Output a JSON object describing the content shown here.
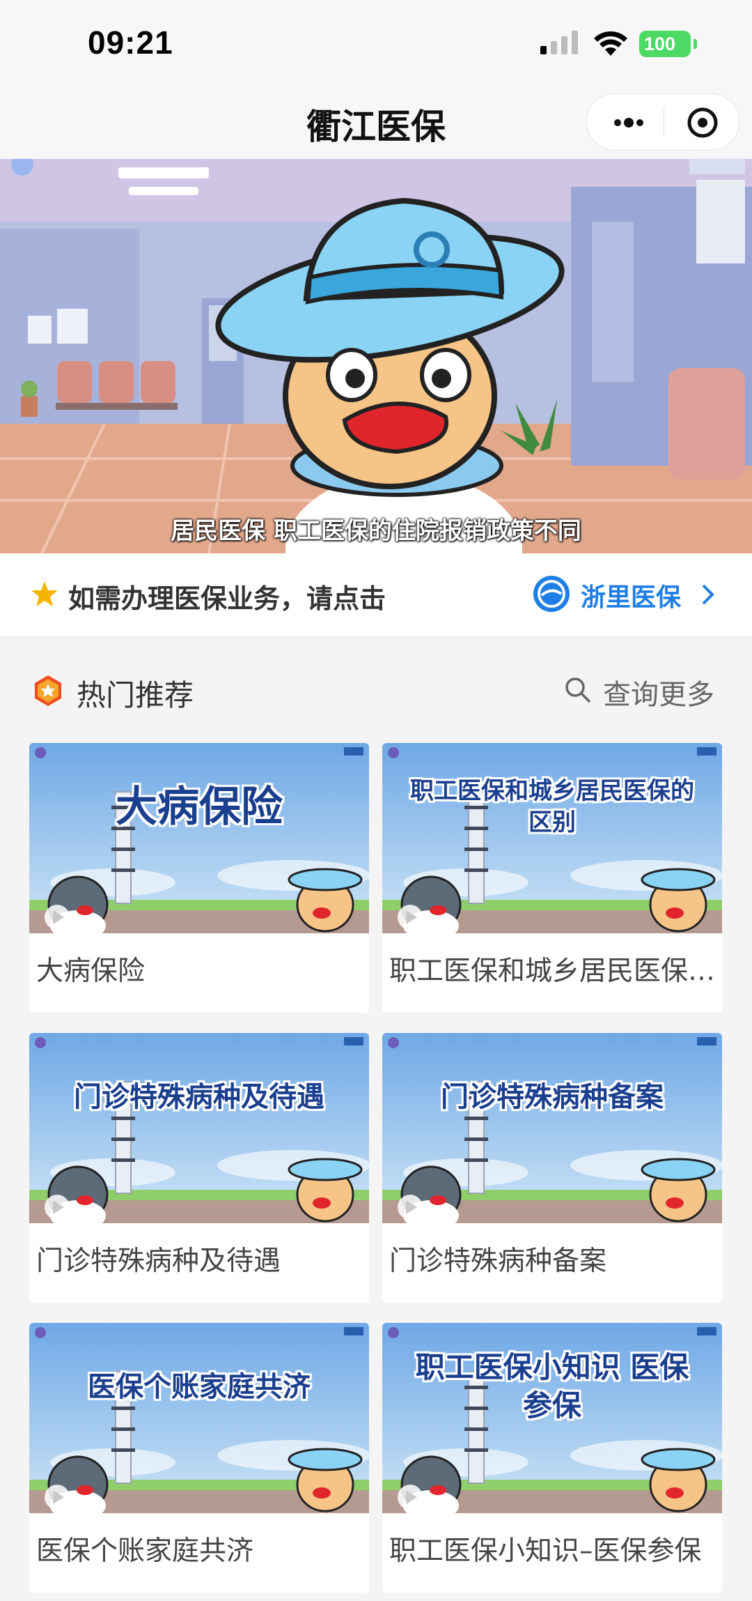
{
  "status_bar": {
    "time": "09:21",
    "battery": "100"
  },
  "nav": {
    "title": "衢江医保"
  },
  "video": {
    "subtitle": "居民医保 职工医保的住院报销政策不同"
  },
  "notice": {
    "text": "如需办理医保业务，请点击",
    "link_label": "浙里医保"
  },
  "section": {
    "title": "热门推荐",
    "search_label": "查询更多"
  },
  "cards": [
    {
      "thumb_title": "大病保险",
      "label": "大病保险"
    },
    {
      "thumb_title": "职工医保和城乡居民医保的区别",
      "label": "职工医保和城乡居民医保的区别"
    },
    {
      "thumb_title": "门诊特殊病种及待遇",
      "label": "门诊特殊病种及待遇"
    },
    {
      "thumb_title": "门诊特殊病种备案",
      "label": "门诊特殊病种备案"
    },
    {
      "thumb_title": "医保个账家庭共济",
      "label": "医保个账家庭共济"
    },
    {
      "thumb_title": "职工医保小知识 医保参保",
      "label": "职工医保小知识–医保参保"
    }
  ],
  "colors": {
    "accent": "#1e7ee6",
    "star": "#f5b400",
    "hot_badge": "#ee4e1f"
  }
}
